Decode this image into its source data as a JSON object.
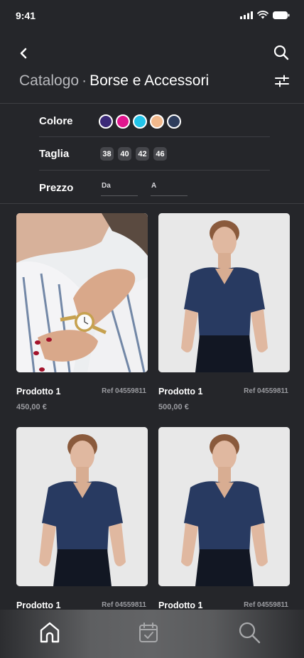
{
  "status_bar": {
    "time": "9:41"
  },
  "header": {
    "title_category": "Catalogo",
    "title_separator": "·",
    "title_section": "Borse e Accessori"
  },
  "filters": {
    "color": {
      "label": "Colore",
      "swatches": [
        "#3b2a78",
        "#e0168e",
        "#22c3e8",
        "#f1b88c",
        "#2e3d5c"
      ]
    },
    "size": {
      "label": "Taglia",
      "options": [
        "38",
        "40",
        "42",
        "46"
      ]
    },
    "price": {
      "label": "Prezzo",
      "from_placeholder": "Da",
      "to_placeholder": "A"
    }
  },
  "products": [
    {
      "name": "Prodotto 1",
      "ref": "Ref 04559811",
      "price": "450,00 €",
      "image": "wrist-watch-photo"
    },
    {
      "name": "Prodotto 1",
      "ref": "Ref 04559811",
      "price": "500,00 €",
      "image": "navy-blouse-photo"
    },
    {
      "name": "Prodotto 1",
      "ref": "Ref 04559811",
      "price": "",
      "image": "navy-blouse-photo"
    },
    {
      "name": "Prodotto 1",
      "ref": "Ref 04559811",
      "price": "",
      "image": "navy-blouse-photo"
    }
  ],
  "tab_bar": {
    "items": [
      {
        "icon": "home-icon",
        "active": true
      },
      {
        "icon": "calendar-check-icon",
        "active": false
      },
      {
        "icon": "search-icon",
        "active": false
      }
    ]
  },
  "colors": {
    "background": "#25262a",
    "divider": "#3d3e43",
    "muted_text": "#9b9ca1"
  }
}
